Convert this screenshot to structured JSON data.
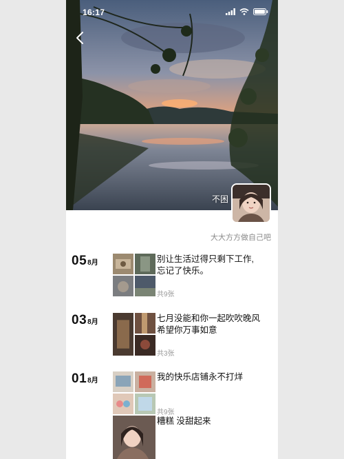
{
  "status_bar": {
    "time": "16:17"
  },
  "profile": {
    "nickname": "不困",
    "signature": "大大方方做自己吧"
  },
  "entries": [
    {
      "day": "05",
      "month": "8月",
      "caption_line1": "别让生活过得只剩下工作,",
      "caption_line2": "忘记了快乐。",
      "count": "共9张"
    },
    {
      "day": "03",
      "month": "8月",
      "caption_line1": "七月没能和你一起吹吹晚风",
      "caption_line2": "希望你万事如意",
      "count": "共3张"
    },
    {
      "day": "01",
      "month": "8月",
      "caption_line1": "我的快乐店铺永不打烊",
      "caption_line2": "",
      "count": "共9张"
    }
  ],
  "extra_entry": {
    "caption": "糟糕 没甜起来"
  },
  "colors": {
    "background": "#ffffff",
    "caption": "#111111",
    "muted": "#8a8a8a"
  },
  "icons": [
    "back-arrow-icon",
    "signal-icon",
    "wifi-icon",
    "battery-icon"
  ]
}
